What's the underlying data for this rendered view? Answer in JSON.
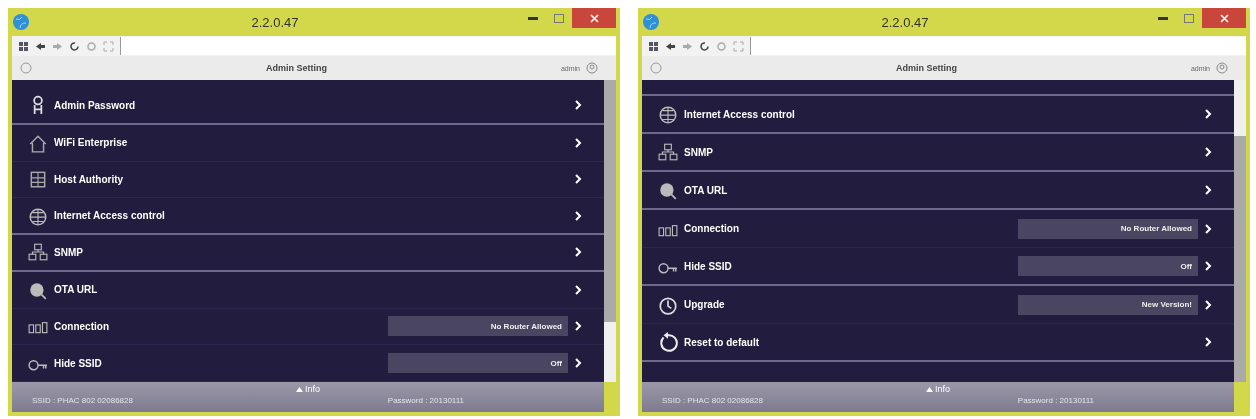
{
  "windows": [
    {
      "title": "2.2.0.47",
      "header": {
        "title": "Admin Setting",
        "user": "admin"
      },
      "rows": [
        {
          "kind": "link",
          "label": "Admin Password",
          "divider": true
        },
        {
          "kind": "link",
          "label": "WiFi Enterprise",
          "divider": false
        },
        {
          "kind": "link",
          "label": "Host Authority",
          "divider": false
        },
        {
          "kind": "link",
          "label": "Internet Access control",
          "divider": true
        },
        {
          "kind": "link",
          "label": "SNMP",
          "divider": true
        },
        {
          "kind": "link",
          "label": "OTA URL",
          "divider": false
        },
        {
          "kind": "value",
          "label": "Connection",
          "value": "No Router Allowed",
          "divider": false
        },
        {
          "kind": "value",
          "label": "Hide SSID",
          "value": "Off",
          "divider": false
        }
      ],
      "footer": {
        "toggle": "Info",
        "ssid": "SSID : PHAC 802 02086828",
        "password": "Password : 20130111"
      }
    },
    {
      "title": "2.2.0.47",
      "header": {
        "title": "Admin Setting",
        "user": "admin"
      },
      "rows": [
        {
          "kind": "link",
          "label": "Internet Access control",
          "divider": true
        },
        {
          "kind": "link",
          "label": "SNMP",
          "divider": true
        },
        {
          "kind": "link",
          "label": "OTA URL",
          "divider": true
        },
        {
          "kind": "value",
          "label": "Connection",
          "value": "No Router Allowed",
          "divider": false
        },
        {
          "kind": "value",
          "label": "Hide SSID",
          "value": "Off",
          "divider": true
        },
        {
          "kind": "value",
          "label": "Upgrade",
          "value": "New Version!",
          "divider": false
        },
        {
          "kind": "link",
          "label": "Reset to default",
          "divider": true
        }
      ],
      "footer": {
        "toggle": "Info",
        "ssid": "SSID : PHAC 802 02086828",
        "password": "Password : 20130111"
      }
    }
  ]
}
